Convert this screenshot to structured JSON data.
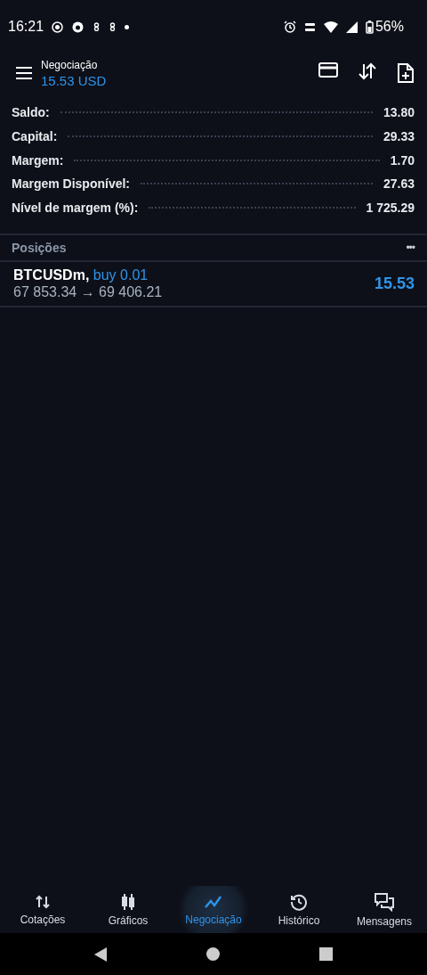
{
  "status_bar": {
    "time": "16:21",
    "battery": "56%"
  },
  "header": {
    "title": "Negociação",
    "balance": "15.53 USD"
  },
  "summary": [
    {
      "label": "Saldo:",
      "value": "13.80"
    },
    {
      "label": "Capital:",
      "value": "29.33"
    },
    {
      "label": "Margem:",
      "value": "1.70"
    },
    {
      "label": "Margem Disponível:",
      "value": "27.63"
    },
    {
      "label": "Nível de margem (%):",
      "value": "1 725.29"
    }
  ],
  "positions": {
    "title": "Posições",
    "menu": "•••",
    "items": [
      {
        "symbol": "BTCUSDm,",
        "side": "buy 0.01",
        "prices": "67 853.34 → 69 406.21",
        "profit": "15.53"
      }
    ]
  },
  "bottom_nav": [
    {
      "kind": "quotes",
      "label": "Cotações",
      "selected": false
    },
    {
      "kind": "charts",
      "label": "Gráficos",
      "selected": false
    },
    {
      "kind": "trade",
      "label": "Negociação",
      "selected": true
    },
    {
      "kind": "history",
      "label": "Histórico",
      "selected": false
    },
    {
      "kind": "messages",
      "label": "Mensagens",
      "selected": false
    }
  ]
}
